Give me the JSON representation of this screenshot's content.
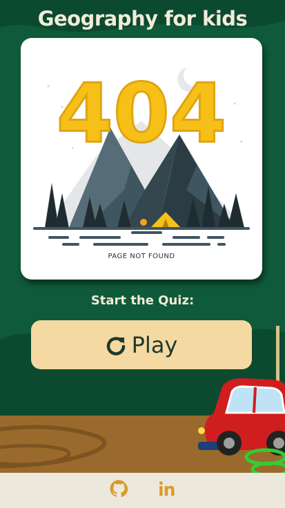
{
  "header": {
    "title": "Geography for kids"
  },
  "card": {
    "error_code": "404",
    "caption": "PAGE NOT FOUND"
  },
  "quiz": {
    "prompt": "Start the Quiz:",
    "play_label": "Play"
  },
  "footer": {
    "icons": [
      "github-icon",
      "linkedin-icon"
    ]
  },
  "colors": {
    "background_green": "#0f5a3a",
    "ground_brown": "#9a6a2c",
    "title_text": "#f1ecd9",
    "button_bg": "#f5d9a3",
    "accent_yellow": "#f7c018",
    "footer_icon": "#d99a2b",
    "footer_bg": "#ece8dc"
  }
}
